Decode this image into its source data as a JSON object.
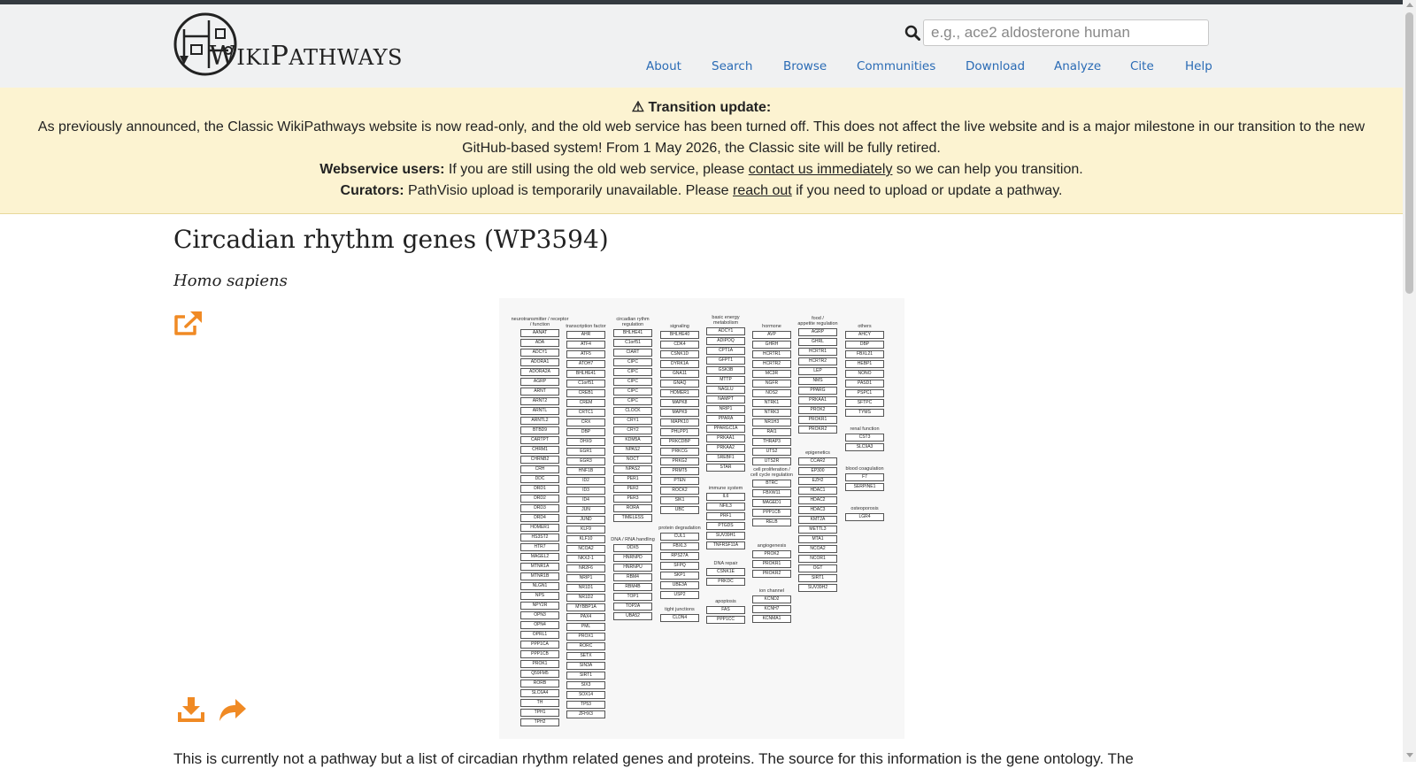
{
  "header": {
    "logo_text_big_w": "W",
    "logo_text_rest1": "IKI",
    "logo_text_big_p": "P",
    "logo_text_rest2": "ATHWAYS",
    "search_placeholder": "e.g., ace2 aldosterone human",
    "nav": [
      "About",
      "Search",
      "Browse",
      "Communities",
      "Download",
      "Analyze",
      "Cite",
      "Help"
    ]
  },
  "banner": {
    "title": "⚠ Transition update:",
    "line1": "As previously announced, the Classic WikiPathways website is now read-only, and the old web service has been turned off. This does not affect the live website and is a major milestone in our transition to the new",
    "line2": "GitHub-based system! From 1 May 2026, the Classic site will be fully retired.",
    "ws_label": "Webservice users:",
    "ws_text1": " If you are still using the old web service, please ",
    "ws_link": "contact us immediately",
    "ws_text2": " so we can help you transition.",
    "cur_label": "Curators:",
    "cur_text1": " PathVisio upload is temporarily unavailable. Please ",
    "cur_link": "reach out",
    "cur_text2": " if you need to upload or update a pathway."
  },
  "page": {
    "title": "Circadian rhythm genes (WP3594)",
    "species": "Homo sapiens",
    "description": "This is currently not a pathway but a list of circadian rhythm related genes and proteins. The source for this information is the gene ontology. The"
  },
  "colors": {
    "accent_orange": "#f08a24",
    "link_blue": "#2a6bb5",
    "banner_bg": "#fcf3d1"
  },
  "icons": {
    "search": "search-icon",
    "open_external": "external-link-icon",
    "download": "download-icon",
    "share": "share-icon"
  },
  "diagram": {
    "groups": [
      {
        "header": "neurotransmitter / receptor\n/ function",
        "genes": [
          "AANAT",
          "ADA",
          "ADCY1",
          "ADORA1",
          "ADORA2A",
          "AGRP",
          "ARNT",
          "ARNT2",
          "ARNTL",
          "ARNTL2",
          "BTBD9",
          "CARTPT",
          "CHRM1",
          "CHRNB2",
          "CRH",
          "DDC",
          "DRD1",
          "DRD2",
          "DRD3",
          "DRD4",
          "HOMER1",
          "HS3ST2",
          "HTR7",
          "MAGEL2",
          "MTNR1A",
          "MTNR1B",
          "NLGN1",
          "NPS",
          "NPY2R",
          "OPN3",
          "OPN4",
          "OPRL1",
          "PPP1CA",
          "PPP1CB",
          "PROK1",
          "Q59FM5",
          "RORB",
          "SLC6A4",
          "TH",
          "TPH1",
          "TPH2"
        ]
      },
      {
        "header": "transcription factor",
        "genes": [
          "AHR",
          "ATF4",
          "ATF5",
          "ATOH7",
          "BHLHE41",
          "C1orf51",
          "CREB1",
          "CREM",
          "CRTC1",
          "CRX",
          "DBP",
          "DHX9",
          "EGR1",
          "EGR3",
          "HNF1B",
          "ID2",
          "ID3",
          "ID4",
          "JUN",
          "JUND",
          "KLF9",
          "KLF10",
          "NCOA2",
          "NKX2-1",
          "NR2F6",
          "NRIP1",
          "NR1D1",
          "NR1D2",
          "MYBBP1A",
          "PAX4",
          "PML",
          "PROX1",
          "RORC",
          "SETX",
          "SIN3A",
          "SIRT1",
          "SIX3",
          "SOX14",
          "TP53",
          "ZFHX3"
        ]
      },
      {
        "header": "circadian rythm\nregulation",
        "genes": [
          "BHLHE41",
          "C1orf51",
          "CIART",
          "CIPC",
          "CIPC",
          "CIPC",
          "CIPC",
          "CIPC",
          "CLOCK",
          "CRY1",
          "CRY2",
          "KDM5A",
          "NPAS2",
          "NOCT",
          "NPAS2",
          "PER1",
          "PER2",
          "PER3",
          "RORA",
          "TIMELESS"
        ]
      },
      {
        "header": "DNA / RNA handling",
        "genes": [
          "DDX5",
          "HNRNPD",
          "HNRNPU",
          "RBM4",
          "RBM4B",
          "TOP1",
          "TOP2A",
          "UBA52"
        ]
      },
      {
        "header": "signaling",
        "genes": [
          "BHLHE40",
          "CDK4",
          "CSNK1D",
          "DYRK1A",
          "GNA11",
          "GNAQ",
          "HOMER1",
          "MAPK8",
          "MAPK9",
          "MAPK10",
          "PHLPP1",
          "PRKCDBP",
          "PRKCG",
          "PRKG2",
          "PRMT5",
          "PTEN",
          "ROCK2",
          "SIK1",
          "UBC"
        ]
      },
      {
        "header": "protein degradation",
        "genes": [
          "CUL1",
          "FBXL3",
          "RPS27A",
          "SFPQ",
          "SKP1",
          "UBE3A",
          "USP2"
        ]
      },
      {
        "header": "tight junctions",
        "genes": [
          "CLDN4"
        ]
      },
      {
        "header": "basic energy\nmetabolism",
        "genes": [
          "ADCY1",
          "ADIPOQ",
          "CPT1A",
          "GFPT1",
          "GSK3B",
          "MTTP",
          "NAGLU",
          "NAMPT",
          "NRIP1",
          "PPARA",
          "PPARGC1A",
          "PRKAA1",
          "PRKAA2",
          "SREBF1",
          "STAR"
        ]
      },
      {
        "header": "immune system",
        "genes": [
          "IL6",
          "NFIL3",
          "PRF1",
          "PTGDS",
          "SUV39H1",
          "TNFRSF11A"
        ]
      },
      {
        "header": "DNA repair",
        "genes": [
          "CSNK1E",
          "PRKDC"
        ]
      },
      {
        "header": "apoptosis",
        "genes": [
          "FAS",
          "PPP1CC"
        ]
      },
      {
        "header": "hormone",
        "genes": [
          "AVP",
          "GHRH",
          "HCRTR1",
          "HCRTR2",
          "MC3R",
          "NGFR",
          "NOS2",
          "NTRK1",
          "NTRK3",
          "NR1H3",
          "RAI1",
          "THRAP3",
          "UTS2",
          "UTS2R"
        ]
      },
      {
        "header": "cell proliferation /\ncell cycle regulation",
        "genes": [
          "BTRC",
          "FBXW11",
          "MAGED1",
          "PPP1CB",
          "RELB"
        ]
      },
      {
        "header": "angiogenesis",
        "genes": [
          "PROK2",
          "PROKR1",
          "PROKR2"
        ]
      },
      {
        "header": "ion channel",
        "genes": [
          "KCND2",
          "KCNH7",
          "KCNMA1"
        ]
      },
      {
        "header": "food /\nappetite regulation",
        "genes": [
          "AGRP",
          "GHRL",
          "HCRTR1",
          "HCRTR2",
          "LEP",
          "NMS",
          "PPARG",
          "PRKAA1",
          "PROK2",
          "PROKR1",
          "PROKR2"
        ]
      },
      {
        "header": "epigenetics",
        "genes": [
          "CCAR2",
          "EP300",
          "EZH2",
          "HDAC1",
          "HDAC2",
          "HDAC3",
          "KMT2A",
          "METTL3",
          "MTA1",
          "NCOA2",
          "NCOR1",
          "OGT",
          "SIRT1",
          "SUV39H2"
        ]
      },
      {
        "header": "others",
        "genes": [
          "AHCY",
          "DBP",
          "FBXL21",
          "HEBP1",
          "NONO",
          "PASD1",
          "PSPC1",
          "SFTPC",
          "TYMS"
        ]
      },
      {
        "header": "renal function",
        "genes": [
          "CST3",
          "SLC9A3"
        ]
      },
      {
        "header": "blood coagulation",
        "genes": [
          "F7",
          "SERPINE1"
        ]
      },
      {
        "header": "osteoporosis",
        "genes": [
          "LGR4"
        ]
      }
    ]
  }
}
